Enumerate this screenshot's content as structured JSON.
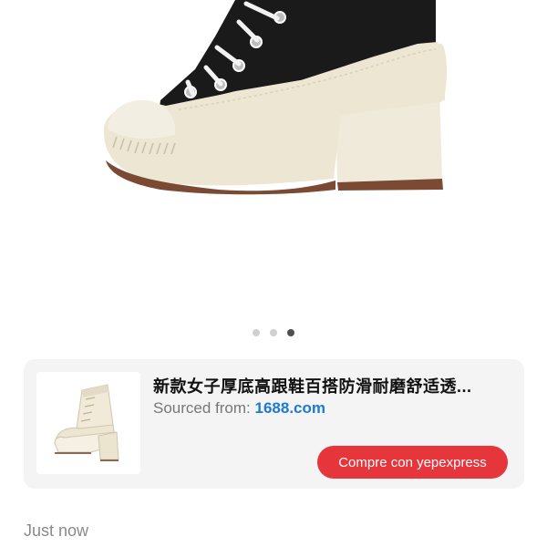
{
  "gallery": {
    "slide_count": 3,
    "active_index": 2
  },
  "product_card": {
    "title": "新款女子厚底高跟鞋百搭防滑耐磨舒适透...",
    "source_label": "Sourced from:",
    "source_site": "1688.com",
    "buy_button_label": "Compre con yepexpress"
  },
  "message": {
    "timestamp": "Just now"
  },
  "colors": {
    "accent": "#e6353b",
    "link": "#1e78d6",
    "card_bg": "#f4f4f4"
  }
}
